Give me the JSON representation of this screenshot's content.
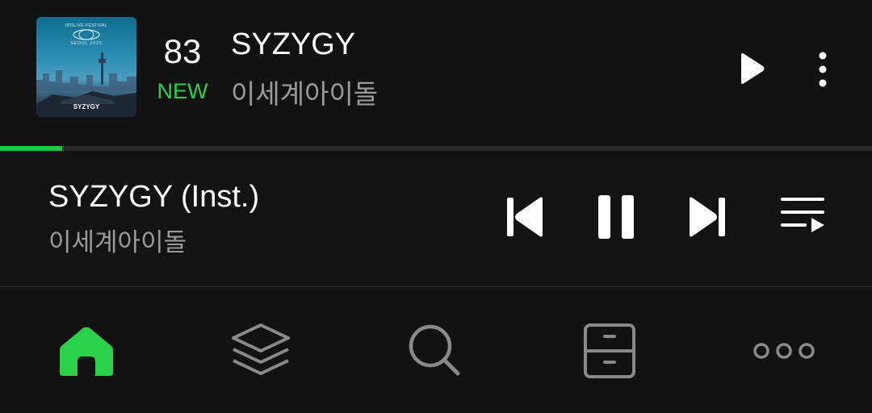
{
  "chart_entry": {
    "rank": "83",
    "rank_status": "NEW",
    "title": "SYZYGY",
    "artist": "이세계아이돌",
    "album_art": {
      "top_text": "IDOLIVE FESTIVAL",
      "sub_text": "SEOUL 2025",
      "artist_text": "SYZYGY"
    },
    "play_icon": "play-icon",
    "more_icon": "more-vertical-icon"
  },
  "progress": {
    "fraction": 0.071,
    "fill_color": "#24c63c",
    "track_color": "#2a2a2a"
  },
  "now_playing": {
    "title": "SYZYGY (Inst.)",
    "artist": "이세계아이돌",
    "controls": [
      "skip-previous-icon",
      "pause-icon",
      "skip-next-icon",
      "queue-list-icon"
    ]
  },
  "bottom_nav": {
    "items": [
      {
        "icon": "home-icon",
        "active": true
      },
      {
        "icon": "layers-icon",
        "active": false
      },
      {
        "icon": "search-icon",
        "active": false
      },
      {
        "icon": "storage-drawer-icon",
        "active": false
      },
      {
        "icon": "more-horizontal-icon",
        "active": false
      }
    ],
    "active_color": "#2bd14a",
    "inactive_color": "#8a8a8a"
  }
}
